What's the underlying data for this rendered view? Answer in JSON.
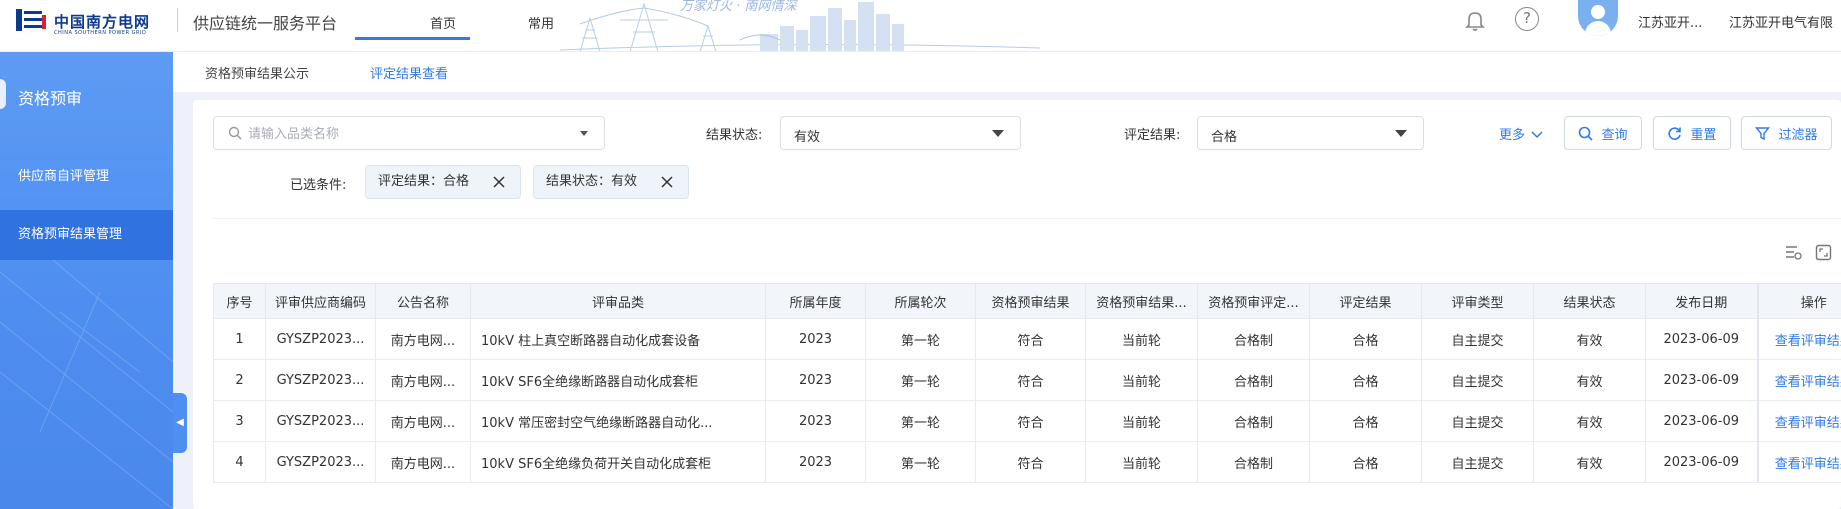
{
  "header": {
    "logo_cn": "中国南方电网",
    "logo_en": "CHINA SOUTHERN POWER GRID",
    "platform_title": "供应链统一服务平台",
    "nav": [
      {
        "label": "首页"
      },
      {
        "label": "常用"
      }
    ],
    "banner_text": "万家灯火 · 南网情深",
    "help_glyph": "?",
    "user_short": "江苏亚开...",
    "user_full": "江苏亚开电气有限"
  },
  "sidebar": {
    "section": "资格预审",
    "items": [
      {
        "label": "供应商自评管理",
        "active": false
      },
      {
        "label": "资格预审结果管理",
        "active": true
      }
    ],
    "collapse_glyph": "◀"
  },
  "tabs": [
    {
      "label": "资格预审结果公示",
      "active": false
    },
    {
      "label": "评定结果查看",
      "active": true
    }
  ],
  "filters": {
    "search_placeholder": "请输入品类名称",
    "search_value": "",
    "status_label": "结果状态:",
    "status_value": "有效",
    "result_label": "评定结果:",
    "result_value": "合格",
    "more_label": "更多",
    "query_label": "查询",
    "reset_label": "重置",
    "filter_label": "过滤器"
  },
  "conditions": {
    "label": "已选条件:",
    "chips": [
      {
        "text": "评定结果：合格"
      },
      {
        "text": "结果状态：有效"
      }
    ]
  },
  "table": {
    "columns": [
      "序号",
      "评审供应商编码",
      "公告名称",
      "评审品类",
      "所属年度",
      "所属轮次",
      "资格预审结果",
      "资格预审结果...",
      "资格预审评定...",
      "评定结果",
      "评审类型",
      "结果状态",
      "发布日期",
      "操作"
    ],
    "rows": [
      [
        "1",
        "GYSZP2023...",
        "南方电网...",
        "10kV 柱上真空断路器自动化成套设备",
        "2023",
        "第一轮",
        "符合",
        "当前轮",
        "合格制",
        "合格",
        "自主提交",
        "有效",
        "2023-06-09",
        "查看评审结果"
      ],
      [
        "2",
        "GYSZP2023...",
        "南方电网...",
        "10kV SF6全绝缘断路器自动化成套柜",
        "2023",
        "第一轮",
        "符合",
        "当前轮",
        "合格制",
        "合格",
        "自主提交",
        "有效",
        "2023-06-09",
        "查看评审结果"
      ],
      [
        "3",
        "GYSZP2023...",
        "南方电网...",
        "10kV 常压密封空气绝缘断路器自动化...",
        "2023",
        "第一轮",
        "符合",
        "当前轮",
        "合格制",
        "合格",
        "自主提交",
        "有效",
        "2023-06-09",
        "查看评审结果"
      ],
      [
        "4",
        "GYSZP2023...",
        "南方电网...",
        "10kV SF6全绝缘负荷开关自动化成套柜",
        "2023",
        "第一轮",
        "符合",
        "当前轮",
        "合格制",
        "合格",
        "自主提交",
        "有效",
        "2023-06-09",
        "查看评审结果"
      ]
    ]
  },
  "colors": {
    "accent": "#2f7be8",
    "sidebar": "#4f8ff0",
    "sidebar_active": "#3073e0",
    "brand": "#0c3b8e"
  },
  "icons": {
    "logo": "csg-logo-icon",
    "bell": "bell-icon",
    "help": "help-icon",
    "avatar": "avatar-icon",
    "search": "search-icon",
    "refresh": "refresh-icon",
    "filter": "filter-icon",
    "close": "close-icon",
    "column_settings": "column-settings-icon",
    "fullscreen": "fullscreen-icon"
  }
}
